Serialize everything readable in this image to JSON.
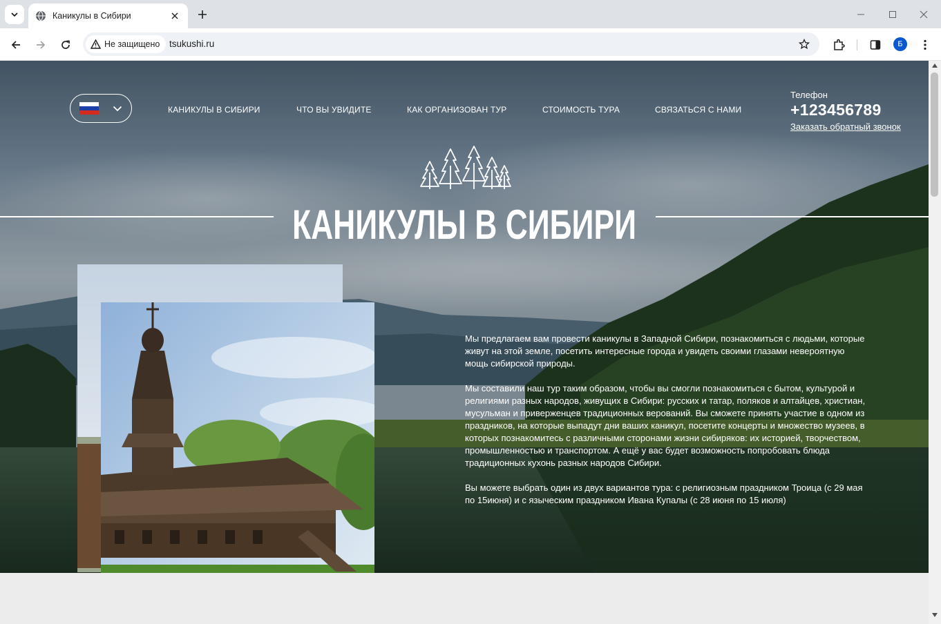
{
  "browser": {
    "tab_title": "Каникулы в Сибири",
    "security_label": "Не защищено",
    "url": "tsukushi.ru",
    "profile_initial": "Б"
  },
  "site": {
    "language": "ru",
    "nav": [
      {
        "label": "КАНИКУЛЫ В СИБИРИ"
      },
      {
        "label": "ЧТО ВЫ УВИДИТЕ"
      },
      {
        "label": "КАК ОРГАНИЗОВАН ТУР"
      },
      {
        "label": "СТОИМОСТЬ ТУРА"
      },
      {
        "label": "СВЯЗАТЬСЯ С НАМИ"
      }
    ],
    "phone_label": "Телефон",
    "phone_number": "+123456789",
    "callback_label": "Заказать обратный звонок",
    "hero_title": "КАНИКУЛЫ В СИБИРИ",
    "paragraphs": [
      "Мы предлагаем вам провести каникулы в Западной Сибири, познакомиться с людьми, которые живут на этой земле, посетить интересные города и увидеть своими глазами невероятную мощь сибирской природы.",
      "Мы составили наш тур таким образом, чтобы вы смогли познакомиться с бытом, культурой и религиями разных народов, живущих в Сибири: русских и татар, поляков и алтайцев, христиан, мусульман и приверженцев традиционных верований. Вы сможете принять участие в одном из праздников, на которые выпадут дни ваших каникул, посетите концерты и множество музеев, в которых познакомитесь с различными сторонами жизни сибиряков: их историей, творчеством, промышленностью и транспортом. А ещё у вас будет возможность попробовать блюда традиционных кухонь разных народов Сибири.",
      "Вы можете выбрать один из двух вариантов тура: с религиозным праздником Троица (с 29 мая по 15июня) и с языческим праздником Ивана Купалы (с 28 июня по 15 июля)"
    ]
  },
  "colors": {
    "flag_white": "#ffffff",
    "flag_blue": "#1c3fa8",
    "flag_red": "#d52b1e",
    "avatar_blue": "#0b57d0"
  }
}
